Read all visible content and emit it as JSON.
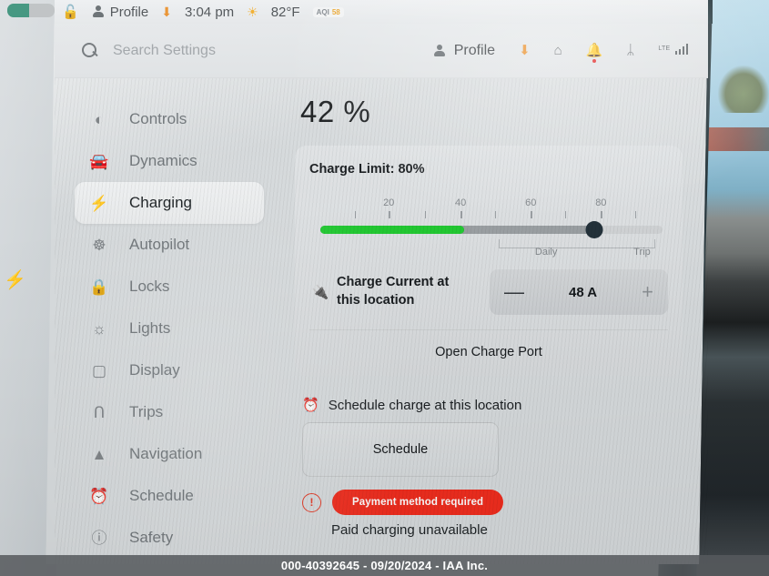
{
  "status_bar": {
    "lock_icon": "unlocked-icon",
    "profile_label": "Profile",
    "download_icon": "download-icon",
    "time": "3:04 pm",
    "weather_icon": "sun-icon",
    "temperature": "82°F",
    "aqi_label": "AQI",
    "aqi_value": "58"
  },
  "header": {
    "search_placeholder": "Search Settings",
    "profile_label": "Profile",
    "icons": [
      {
        "name": "software-update-icon",
        "glyph": "⬇"
      },
      {
        "name": "garage-icon",
        "glyph": "⌂"
      },
      {
        "name": "notification-bell-icon",
        "glyph": "🔔"
      },
      {
        "name": "bluetooth-icon",
        "glyph": "ᛦ"
      },
      {
        "name": "lte-signal-icon",
        "glyph": "LTE"
      }
    ]
  },
  "sidebar": {
    "items": [
      {
        "label": "Controls",
        "icon": "toggle-icon",
        "glyph": "◐",
        "active": false
      },
      {
        "label": "Dynamics",
        "icon": "car-icon",
        "glyph": "🚗",
        "active": false
      },
      {
        "label": "Charging",
        "icon": "lightning-bolt-icon",
        "glyph": "⚡",
        "active": true
      },
      {
        "label": "Autopilot",
        "icon": "steering-wheel-icon",
        "glyph": "☸",
        "active": false
      },
      {
        "label": "Locks",
        "icon": "lock-icon",
        "glyph": "🔒",
        "active": false
      },
      {
        "label": "Lights",
        "icon": "brightness-icon",
        "glyph": "☀",
        "active": false
      },
      {
        "label": "Display",
        "icon": "display-icon",
        "glyph": "▢",
        "active": false
      },
      {
        "label": "Trips",
        "icon": "trips-icon",
        "glyph": "Ո",
        "active": false
      },
      {
        "label": "Navigation",
        "icon": "navigation-arrow-icon",
        "glyph": "▲",
        "active": false
      },
      {
        "label": "Schedule",
        "icon": "alarm-clock-icon",
        "glyph": "⏰",
        "active": false
      },
      {
        "label": "Safety",
        "icon": "warning-circle-icon",
        "glyph": "ⓘ",
        "active": false
      }
    ]
  },
  "main": {
    "battery_percent": "42 %",
    "charge_limit_label": "Charge Limit: 80%",
    "slider": {
      "value": 80,
      "battery_level": 42,
      "min": 0,
      "max": 100,
      "tick_labels": [
        "20",
        "40",
        "60",
        "80"
      ],
      "tick_values": [
        20,
        40,
        60,
        80
      ],
      "range_labels": [
        "Daily",
        "Trip"
      ],
      "green_color": "#22c832",
      "track_color": "#9a9fa2",
      "thumb_color": "#23313a"
    },
    "charge_current": {
      "icon": "charge-plug-icon",
      "label_line1": "Charge Current at",
      "label_line2": "this location",
      "minus_label": "—",
      "value": "48 A",
      "plus_label": "+"
    },
    "open_charge_port_label": "Open Charge Port",
    "schedule_row_label": "Schedule charge at this location",
    "schedule_row_icon": "alarm-clock-icon",
    "schedule_button_label": "Schedule",
    "payment_warning_icon": "warning-icon",
    "payment_badge_label": "Payment method required",
    "payment_badge_color": "#ef2d1e",
    "paid_charging_text": "Paid charging unavailable"
  },
  "watermark": "000-40392645 - 09/20/2024 - IAA Inc."
}
